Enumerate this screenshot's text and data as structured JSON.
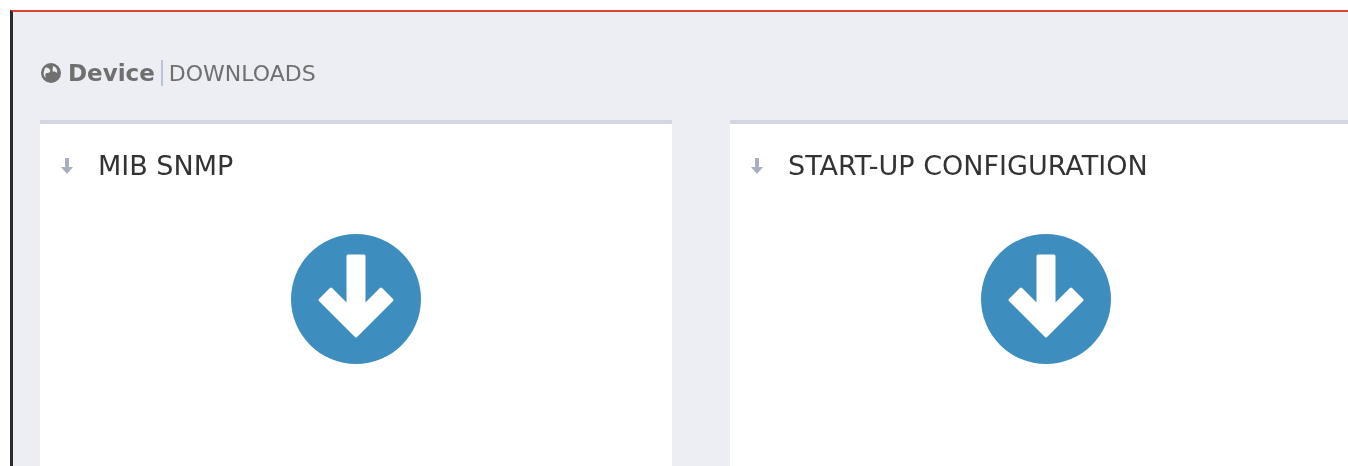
{
  "breadcrumb": {
    "section": "Device",
    "page": "DOWNLOADS"
  },
  "cards": [
    {
      "title": "MIB SNMP"
    },
    {
      "title": "START-UP CONFIGURATION"
    }
  ]
}
